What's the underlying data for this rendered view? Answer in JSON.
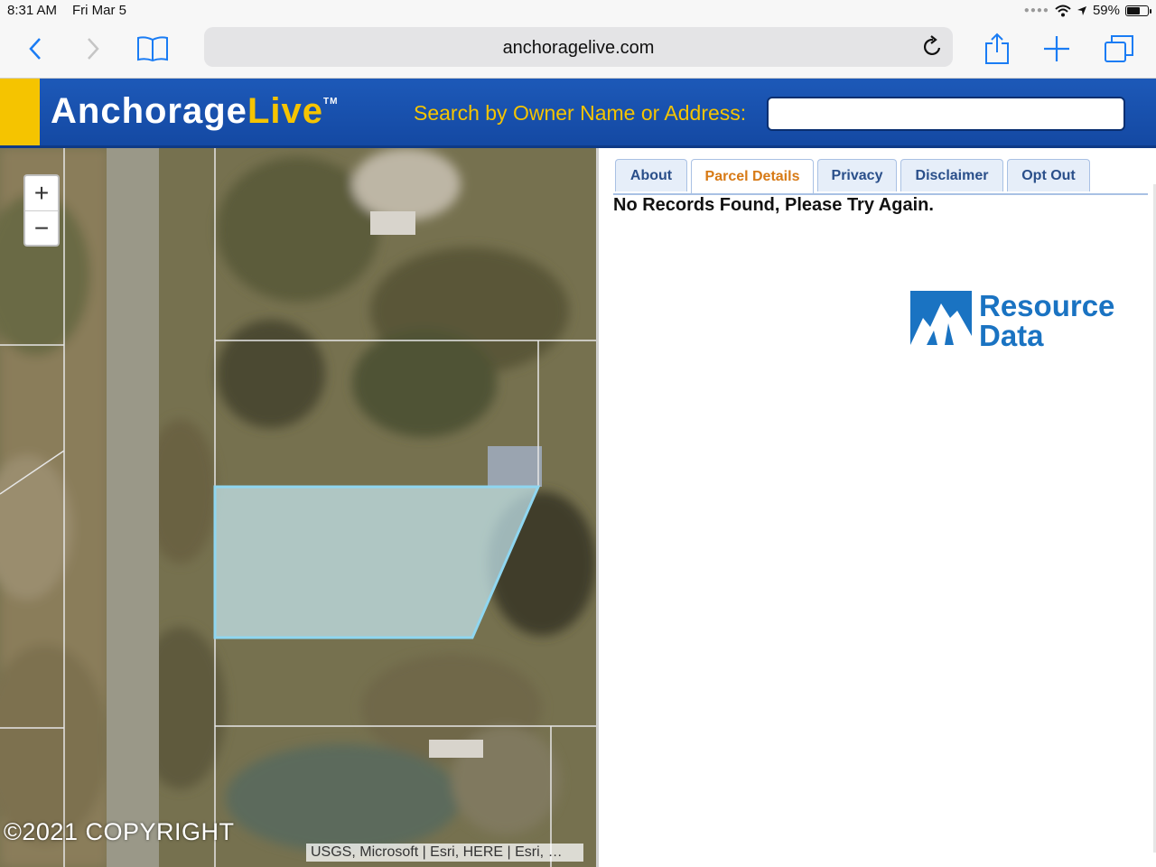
{
  "status_bar": {
    "time": "8:31 AM",
    "date": "Fri Mar 5",
    "battery": "59%",
    "battery_level": 0.59
  },
  "browser": {
    "url": "anchoragelive.com",
    "icons": [
      "back-chevron-icon",
      "forward-chevron-icon",
      "bookmarks-icon",
      "reload-icon",
      "share-icon",
      "plus-icon",
      "tabs-icon"
    ]
  },
  "header": {
    "logo_part1": "Anchorage",
    "logo_part2": "Live",
    "logo_tm": "TM",
    "search_label": "Search by Owner Name or Address:",
    "search_value": "",
    "colors": {
      "header_blue": "#1d59b8",
      "accent_yellow": "#f5c400"
    }
  },
  "map": {
    "zoom_in": "+",
    "zoom_out": "−",
    "copyright": "©2021 COPYRIGHT",
    "attribution": "USGS, Microsoft | Esri, HERE | Esri, …"
  },
  "panel": {
    "tabs": [
      {
        "label": "About",
        "active": false
      },
      {
        "label": "Parcel Details",
        "active": true
      },
      {
        "label": "Privacy",
        "active": false
      },
      {
        "label": "Disclaimer",
        "active": false
      },
      {
        "label": "Opt Out",
        "active": false
      }
    ],
    "message": "No Records Found, Please Try Again.",
    "brand_line1": "Resource",
    "brand_line2": "Data",
    "brand_color": "#1a73c2"
  }
}
